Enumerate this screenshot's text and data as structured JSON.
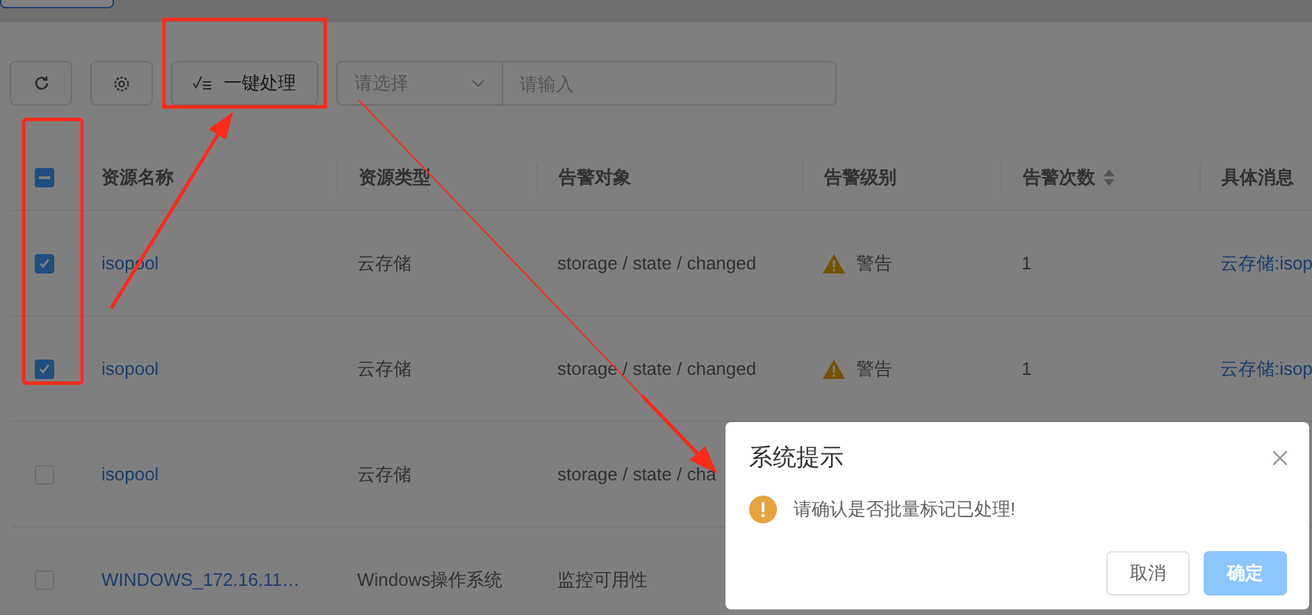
{
  "toolbar": {
    "action_button": "一键处理",
    "select": {
      "placeholder": "请选择"
    },
    "search": {
      "placeholder": "请输入"
    }
  },
  "table": {
    "header_checkbox": {
      "indeterminate": true
    },
    "columns": [
      {
        "label": "资源名称",
        "sortable": false
      },
      {
        "label": "资源类型",
        "sortable": false
      },
      {
        "label": "告警对象",
        "sortable": false
      },
      {
        "label": "告警级别",
        "sortable": false
      },
      {
        "label": "告警次数",
        "sortable": true
      },
      {
        "label": "具体消息",
        "sortable": false
      }
    ],
    "rows": [
      {
        "selected": true,
        "cells": [
          "isopool",
          "云存储",
          "storage / state / changed",
          "警告",
          "1",
          "云存储:isop"
        ]
      },
      {
        "selected": true,
        "cells": [
          "isopool",
          "云存储",
          "storage / state / changed",
          "警告",
          "1",
          "云存储:isop"
        ]
      },
      {
        "selected": false,
        "cells": [
          "isopool",
          "云存储",
          "storage / state / cha"
        ]
      },
      {
        "selected": false,
        "cells": [
          "WINDOWS_172.16.11…",
          "Windows操作系统",
          "监控可用性"
        ]
      }
    ]
  },
  "dialog": {
    "title": "系统提示",
    "message": "请确认是否批量标记已处理!",
    "buttons": [
      {
        "label": "取消",
        "kind": "default"
      },
      {
        "label": "确定",
        "kind": "primary"
      }
    ]
  }
}
